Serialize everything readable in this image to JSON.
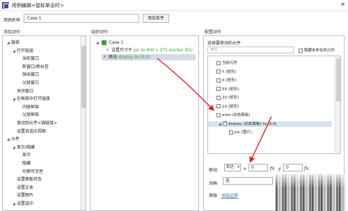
{
  "window": {
    "title": "用例编辑<鼠标单击时>",
    "close_glyph": "✕"
  },
  "case_name": {
    "label": "用例名称",
    "value": "Case 1",
    "add_condition_label": "添加条件"
  },
  "headings": {
    "add_action": "添加动作",
    "organize_action": "组织动作",
    "config_action": "配置动作"
  },
  "left_tree": [
    {
      "label": "链接",
      "indent": 0,
      "toggle": "◢"
    },
    {
      "label": "打开链接",
      "indent": 1,
      "toggle": "◢"
    },
    {
      "label": "当前窗口",
      "indent": 2,
      "toggle": ""
    },
    {
      "label": "新窗口/新标签",
      "indent": 2,
      "toggle": ""
    },
    {
      "label": "弹出窗口",
      "indent": 2,
      "toggle": ""
    },
    {
      "label": "父级窗口",
      "indent": 2,
      "toggle": ""
    },
    {
      "label": "关闭窗口",
      "indent": 1,
      "toggle": ""
    },
    {
      "label": "在框架中打开链接",
      "indent": 1,
      "toggle": "◢"
    },
    {
      "label": "内联框架",
      "indent": 2,
      "toggle": ""
    },
    {
      "label": "父级框架",
      "indent": 2,
      "toggle": ""
    },
    {
      "label": "滚动到元件<锚链接>",
      "indent": 1,
      "toggle": ""
    },
    {
      "label": "设置自适应视图",
      "indent": 1,
      "toggle": ""
    },
    {
      "label": "元件",
      "indent": 0,
      "toggle": "◢"
    },
    {
      "label": "显示/隐藏",
      "indent": 1,
      "toggle": "◢"
    },
    {
      "label": "显示",
      "indent": 2,
      "toggle": ""
    },
    {
      "label": "隐藏",
      "indent": 2,
      "toggle": ""
    },
    {
      "label": "切换可见性",
      "indent": 2,
      "toggle": ""
    },
    {
      "label": "设置面板状态",
      "indent": 1,
      "toggle": ""
    },
    {
      "label": "设置文本",
      "indent": 1,
      "toggle": ""
    },
    {
      "label": "设置图片",
      "indent": 1,
      "toggle": ""
    },
    {
      "label": "设置选中",
      "indent": 1,
      "toggle": "◢"
    }
  ],
  "middle_tree": {
    "case_toggle": "◢",
    "case_label": "Case 1",
    "actions": [
      {
        "name": "设置尺寸于",
        "detail": "pic to 600 x 375 anchor 中心",
        "selected": false
      },
      {
        "name": "移动",
        "detail": "display to (0,0)",
        "selected": true
      }
    ]
  },
  "config": {
    "choose_label": "选择要移动的元件",
    "search_placeholder": "查找",
    "hide_unnamed_label": "隐藏未命名的元件",
    "widgets": [
      {
        "label": "当前元件",
        "indent": 0,
        "checked": false,
        "toggle": "",
        "highlighted": false
      },
      {
        "label": "Y (矩形)",
        "indent": 0,
        "checked": false,
        "toggle": "",
        "highlighted": false
      },
      {
        "label": "X (矩形)",
        "indent": 0,
        "checked": false,
        "toggle": "",
        "highlighted": false
      },
      {
        "label": "5X (矩形)",
        "indent": 0,
        "checked": false,
        "toggle": "",
        "highlighted": false
      },
      {
        "label": "2X (矩形)",
        "indent": 0,
        "checked": false,
        "toggle": "",
        "highlighted": false
      },
      {
        "label": "1X (矩形)",
        "indent": 0,
        "checked": false,
        "toggle": "",
        "highlighted": false
      },
      {
        "label": "area (动态面板)",
        "indent": 0,
        "checked": false,
        "toggle": "",
        "highlighted": false
      },
      {
        "label": "display (动态面板) to (0,0)",
        "indent": 1,
        "checked": true,
        "toggle": "◢",
        "highlighted": true
      },
      {
        "label": "pic (图片)",
        "indent": 2,
        "checked": false,
        "toggle": "",
        "highlighted": false
      }
    ],
    "move": {
      "label": "移动",
      "mode": "到达",
      "mode_arrow": "▾",
      "x_label": "x",
      "x_value": "0",
      "y_label": "y",
      "y_value": "0",
      "fx": "fx"
    },
    "animation": {
      "label": "动画",
      "value": "无"
    },
    "boundary": {
      "label": "界限",
      "link": "添加边界"
    }
  },
  "accent_colors": {
    "annotation_arrow": "#e02020",
    "green_detail": "#2aa033",
    "selection": "#d2dbe6"
  }
}
